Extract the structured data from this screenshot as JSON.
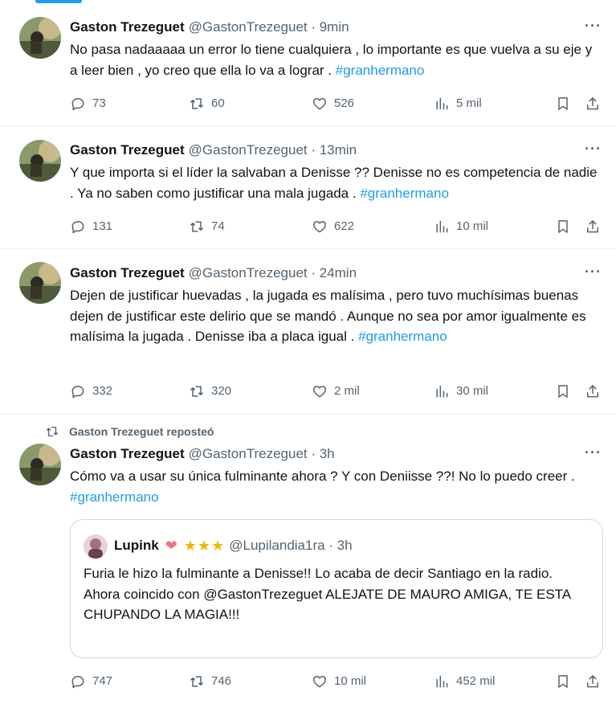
{
  "tweets": [
    {
      "name": "Gaston Trezeguet",
      "handle": "@GastonTrezeguet · 9min",
      "more": "···",
      "text": "No pasa nadaaaaa un error lo tiene cualquiera , lo importante es que vuelva a su eje y a leer bien , yo creo que ella lo va a lograr .",
      "hashtag": "#granhermano",
      "replies": "73",
      "reposts": "60",
      "likes": "526",
      "views": "5 mil"
    },
    {
      "name": "Gaston Trezeguet",
      "handle": "@GastonTrezeguet · 13min",
      "more": "···",
      "text": "Y que importa si el líder la salvaban a Denisse ?? Denisse no es competencia de nadie . Ya no saben como justificar una mala jugada .",
      "hashtag": "#granhermano",
      "replies": "131",
      "reposts": "74",
      "likes": "622",
      "views": "10 mil"
    },
    {
      "name": "Gaston Trezeguet",
      "handle": "@GastonTrezeguet · 24min",
      "more": "···",
      "text": "Dejen de justificar huevadas , la jugada es malísima , pero tuvo muchísimas buenas dejen de justificar este delirio que se mandó . Aunque no sea por amor igualmente es malísima la jugada . Denisse iba a placa igual .",
      "hashtag": "#granhermano",
      "replies": "332",
      "reposts": "320",
      "likes": "2 mil",
      "views": "30 mil"
    },
    {
      "repost_label": "Gaston Trezeguet reposteó",
      "name": "Gaston Trezeguet",
      "handle": "@GastonTrezeguet · 3h",
      "more": "···",
      "text": "Cómo va a usar su única fulminante ahora ?  Y con Deniisse ??! No lo puedo creer .",
      "hashtag": "#granhermano",
      "replies": "747",
      "reposts": "746",
      "likes": "10 mil",
      "views": "452 mil",
      "quote": {
        "name": "Lupink",
        "heart": "❤",
        "stars": "★★★",
        "handle": "@Lupilandia1ra · 3h",
        "line1": "Furia le hizo la fulminante a Denisse!! Lo acaba de decir Santiago en la radio.",
        "line2": "Ahora coincido con @GastonTrezeguet ALEJATE DE MAURO AMIGA, TE ESTA CHUPANDO LA MAGIA!!!"
      }
    }
  ],
  "icons": {
    "reply": "reply-icon",
    "repost": "repost-icon",
    "like": "like-icon",
    "views": "views-icon",
    "bookmark": "bookmark-icon",
    "share": "share-icon"
  },
  "colors": {
    "accent": "#1d9bf0",
    "text": "#0f1419",
    "secondary": "#536471",
    "border": "#eff3f4"
  }
}
